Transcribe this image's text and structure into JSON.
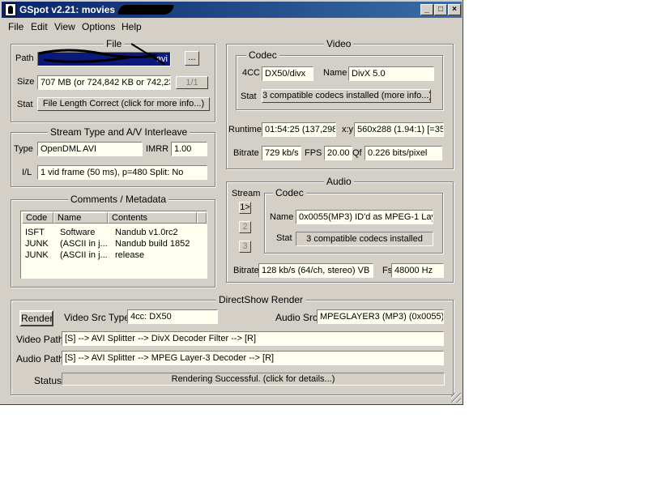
{
  "window": {
    "title": "GSpot v2.21: movies",
    "buttons": {
      "minimize": "_",
      "maximize": "□",
      "close": "×"
    }
  },
  "menu": [
    "File",
    "Edit",
    "View",
    "Options",
    "Help"
  ],
  "file_group": {
    "legend": "File",
    "path_label": "Path",
    "path_value": "avi",
    "browse_label": "...",
    "index_label": "1/1",
    "size_label": "Size",
    "size_value": "707 MB (or 724,842 KB or 742,23",
    "stat_label": "Stat",
    "stat_button": "File Length Correct (click for more info...)"
  },
  "stream_group": {
    "legend": "Stream Type and A/V Interleave",
    "type_label": "Type",
    "type_value": "OpenDML AVI",
    "imrr_label": "IMRR",
    "imrr_value": "1.00",
    "il_label": "I/L",
    "il_value": "1 vid frame (50 ms), p=480  Split: No"
  },
  "comments_group": {
    "legend": "Comments / Metadata",
    "columns": [
      "Code",
      "Name",
      "Contents"
    ],
    "rows": [
      [
        "ISFT",
        "Software",
        "Nandub v1.0rc2"
      ],
      [
        "JUNK",
        "(ASCII in j...",
        "Nandub build 1852"
      ],
      [
        "JUNK",
        "(ASCII in j...",
        "release"
      ]
    ]
  },
  "video_group": {
    "legend": "Video",
    "codec_legend": "Codec",
    "fourcc_label": "4CC",
    "fourcc_value": "DX50/divx",
    "name_label": "Name",
    "name_value": "DivX 5.0",
    "stat_label": "Stat",
    "stat_button": "3 compatible codecs installed (more info...)",
    "runtime_label": "Runtime",
    "runtime_value": "01:54:25 (137,298",
    "xy_label": "x:y",
    "xy_value": "560x288 (1.94:1) [=35",
    "bitrate_label": "Bitrate",
    "bitrate_value": "729 kb/s",
    "fps_label": "FPS",
    "fps_value": "20.00",
    "qf_label": "Qf",
    "qf_value": "0.226 bits/pixel"
  },
  "audio_group": {
    "legend": "Audio",
    "stream_label": "Stream",
    "stream_buttons": [
      "1>",
      "2",
      "3"
    ],
    "codec_legend": "Codec",
    "name_label": "Name",
    "name_value": "0x0055(MP3) ID'd as MPEG-1 Lay",
    "stat_label": "Stat",
    "stat_value": "3 compatible codecs installed",
    "bitrate_label": "Bitrate",
    "bitrate_value": "128 kb/s (64/ch, stereo) VB",
    "fs_label": "Fs",
    "fs_value": "48000 Hz"
  },
  "render_group": {
    "legend": "DirectShow Render",
    "render_button": "Render",
    "video_src_label": "Video Src Type",
    "video_src_value": "4cc: DX50",
    "audio_src_label": "Audio Src",
    "audio_src_value": "MPEGLAYER3 (MP3) (0x0055)",
    "video_path_label": "Video Path",
    "video_path_value": "[S] --> AVI Splitter --> DivX Decoder Filter --> [R]",
    "audio_path_label": "Audio Path",
    "audio_path_value": "[S] --> AVI Splitter --> MPEG Layer-3 Decoder --> [R]",
    "status_label": "Status",
    "status_value": "Rendering Successful.  (click for details...)"
  }
}
